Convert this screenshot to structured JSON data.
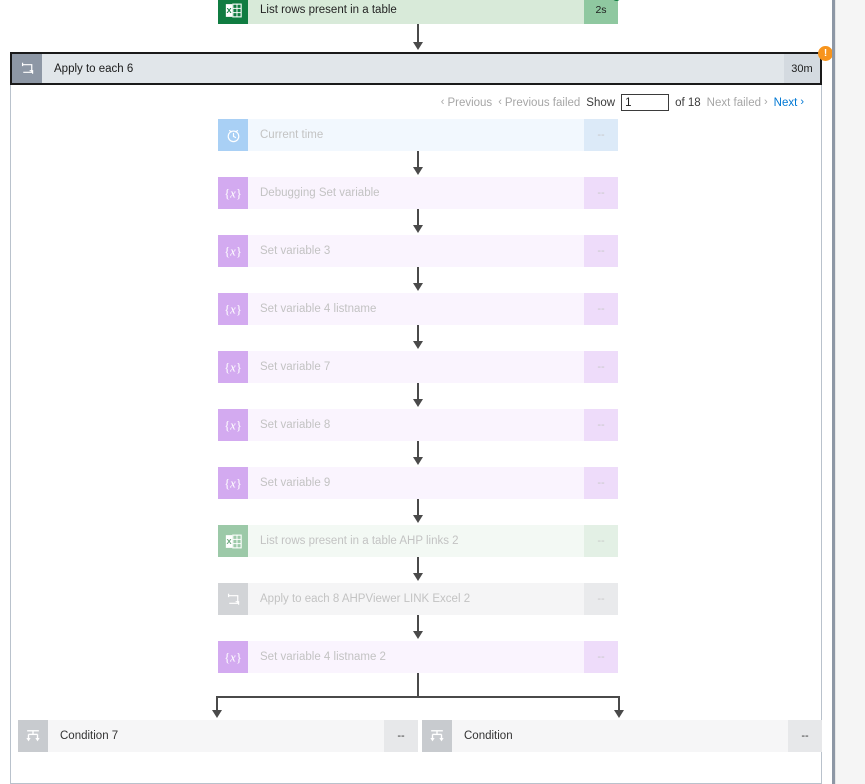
{
  "workflow": {
    "top_action": {
      "label": "List rows present in a table",
      "duration": "2s",
      "icon": "excel-icon",
      "status": "succeeded"
    },
    "scope": {
      "label": "Apply to each 6",
      "duration": "30m",
      "icon": "loop-icon",
      "warning_badge": "!"
    },
    "pagination": {
      "previous_label": "Previous",
      "previous_failed_label": "Previous failed",
      "show_label": "Show",
      "page_value": "1",
      "of_label": "of 18",
      "next_failed_label": "Next failed",
      "next_label": "Next",
      "chevron_left": "‹",
      "chevron_right": "›"
    },
    "inner_actions": [
      {
        "label": "Current time",
        "duration": "--",
        "icon": "clock-icon",
        "kind": "clock"
      },
      {
        "label": "Debugging Set variable",
        "duration": "--",
        "icon": "variable-icon",
        "kind": "var"
      },
      {
        "label": "Set variable 3",
        "duration": "--",
        "icon": "variable-icon",
        "kind": "var"
      },
      {
        "label": "Set variable 4 listname",
        "duration": "--",
        "icon": "variable-icon",
        "kind": "var"
      },
      {
        "label": "Set variable 7",
        "duration": "--",
        "icon": "variable-icon",
        "kind": "var"
      },
      {
        "label": "Set variable 8",
        "duration": "--",
        "icon": "variable-icon",
        "kind": "var"
      },
      {
        "label": "Set variable 9",
        "duration": "--",
        "icon": "variable-icon",
        "kind": "var"
      },
      {
        "label": "List rows present in a table AHP links 2",
        "duration": "--",
        "icon": "excel-icon",
        "kind": "excel"
      },
      {
        "label": "Apply to each 8 AHPViewer LINK Excel 2",
        "duration": "--",
        "icon": "loop-icon",
        "kind": "loop"
      },
      {
        "label": "Set variable 4 listname 2",
        "duration": "--",
        "icon": "variable-icon",
        "kind": "var"
      }
    ],
    "branch_actions": [
      {
        "label": "Condition 7",
        "duration": "--",
        "icon": "condition-icon",
        "kind": "cond"
      },
      {
        "label": "Condition",
        "duration": "--",
        "icon": "condition-icon",
        "kind": "cond"
      }
    ]
  },
  "colors": {
    "excel_green": "#107c41",
    "scope_gray": "#8d97a5",
    "variable_purple": "#d3aaf0",
    "clock_blue": "#a9d0f5",
    "warning_orange": "#f7941d",
    "link_blue": "#0078d4"
  }
}
